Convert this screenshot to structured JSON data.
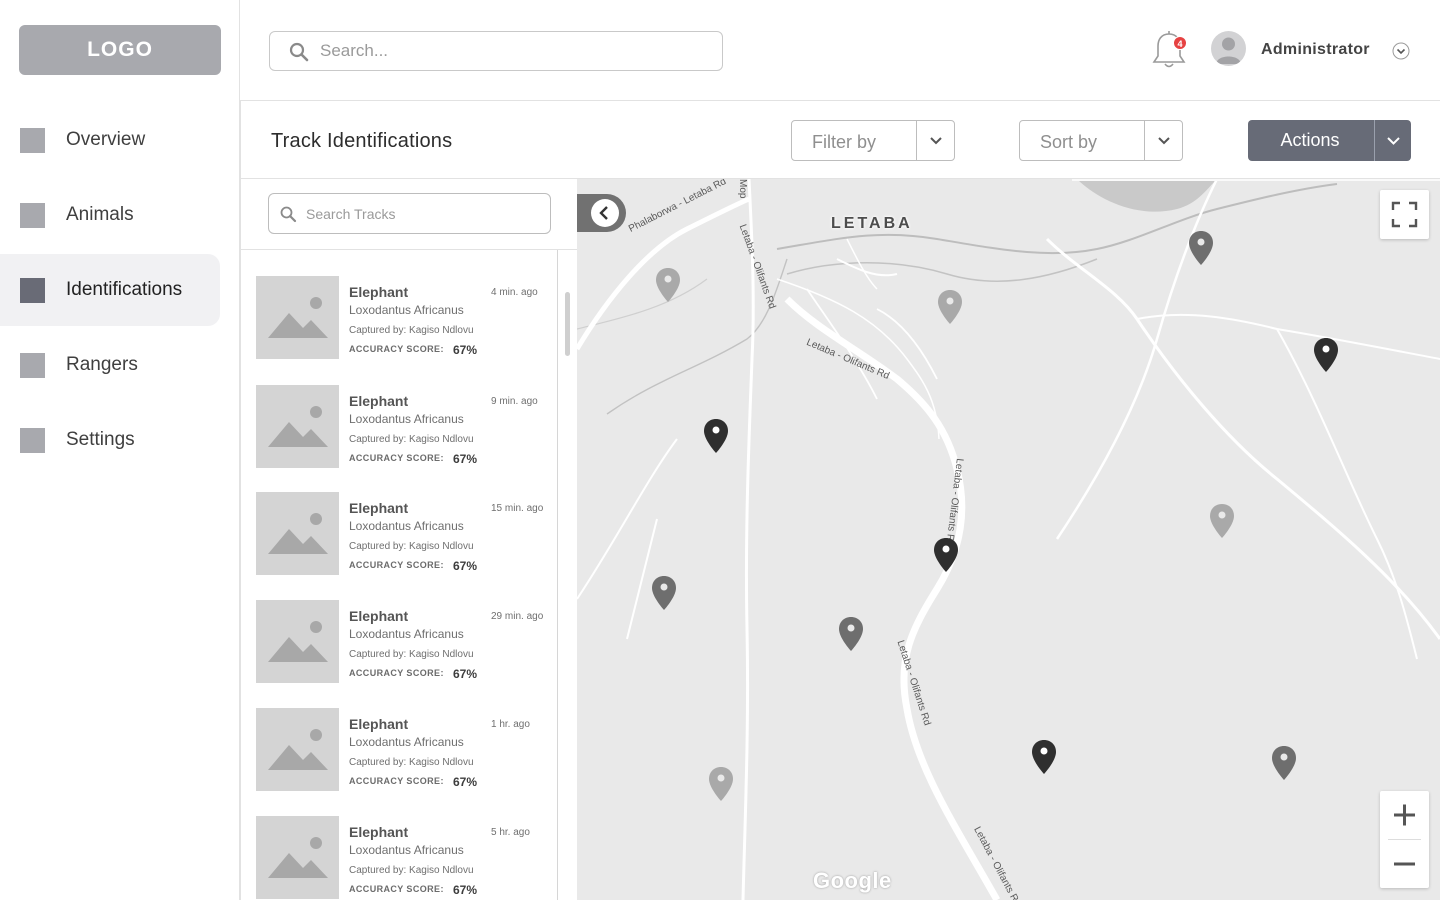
{
  "logo": "LOGO",
  "sidebar": {
    "items": [
      {
        "label": "Overview"
      },
      {
        "label": "Animals"
      },
      {
        "label": "Identifications",
        "active": true
      },
      {
        "label": "Rangers"
      },
      {
        "label": "Settings"
      }
    ]
  },
  "topbar": {
    "search_placeholder": "Search...",
    "notification_count": "4",
    "user_name": "Administrator"
  },
  "page": {
    "title": "Track Identifications",
    "filter_label": "Filter by",
    "sort_label": "Sort by",
    "actions_label": "Actions"
  },
  "tracks": {
    "search_placeholder": "Search Tracks",
    "items": [
      {
        "name": "Elephant",
        "species": "Loxodantus Africanus",
        "captured_by": "Captured by: Kagiso Ndlovu",
        "accuracy_label": "ACCURACY SCORE:",
        "accuracy": "67%",
        "time": "4 min. ago"
      },
      {
        "name": "Elephant",
        "species": "Loxodantus Africanus",
        "captured_by": "Captured by: Kagiso Ndlovu",
        "accuracy_label": "ACCURACY SCORE:",
        "accuracy": "67%",
        "time": "9 min. ago"
      },
      {
        "name": "Elephant",
        "species": "Loxodantus Africanus",
        "captured_by": "Captured by: Kagiso Ndlovu",
        "accuracy_label": "ACCURACY SCORE:",
        "accuracy": "67%",
        "time": "15 min. ago"
      },
      {
        "name": "Elephant",
        "species": "Loxodantus Africanus",
        "captured_by": "Captured by: Kagiso Ndlovu",
        "accuracy_label": "ACCURACY SCORE:",
        "accuracy": "67%",
        "time": "29  min. ago"
      },
      {
        "name": "Elephant",
        "species": "Loxodantus Africanus",
        "captured_by": "Captured by: Kagiso Ndlovu",
        "accuracy_label": "ACCURACY SCORE:",
        "accuracy": "67%",
        "time": "1 hr. ago"
      },
      {
        "name": "Elephant",
        "species": "Loxodantus Africanus",
        "captured_by": "Captured by: Kagiso Ndlovu",
        "accuracy_label": "ACCURACY SCORE:",
        "accuracy": "67%",
        "time": "5 hr. ago"
      }
    ]
  },
  "map": {
    "town": "LETABA",
    "roads": [
      "Phalaborwa - Letaba Rd",
      "Letaba - Olifants Rd",
      "Letaba - Olifants Rd",
      "Letaba - Olifants Rd",
      "Letaba - Olifants Rd",
      "Letaba - Olifants Rd",
      "Mop"
    ],
    "attribution": "Google",
    "colors": {
      "pin_dark": "#2f2f2f",
      "pin_mid": "#6e6e6e",
      "pin_light": "#a9a9a9"
    }
  }
}
